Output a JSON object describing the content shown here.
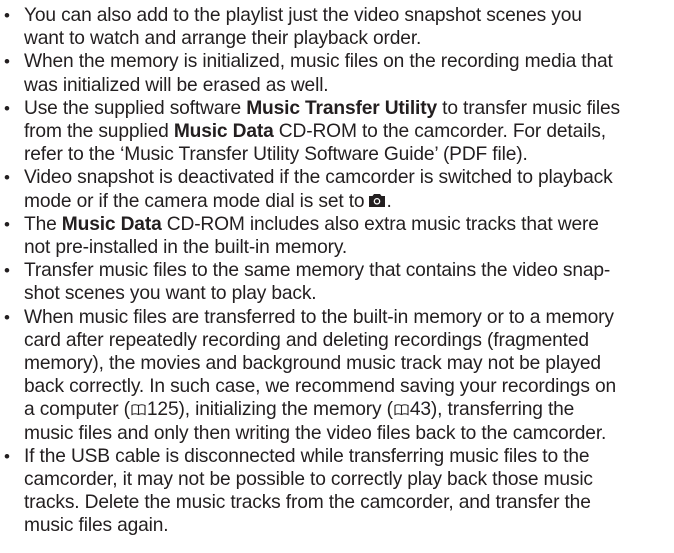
{
  "notes": [
    {
      "lines": [
        "You can also add to the playlist just the video snapshot scenes you",
        "want to watch and arrange their playback order."
      ]
    },
    {
      "lines": [
        "When the memory is initialized, music files on the recording media that",
        "was initialized will be erased as well."
      ]
    },
    {
      "l1a": "Use the supplied software ",
      "l1b": "Music Transfer Utility",
      "l1c": " to transfer music files",
      "l2a": "from the supplied ",
      "l2b": "Music Data",
      "l2c": " CD-ROM to the camcorder. For details,",
      "l3": "refer to the ‘Music Transfer Utility Software Guide’ (PDF file)."
    },
    {
      "l1": "Video snapshot is deactivated if the camcorder is switched to playback",
      "l2a": "mode or if the camera mode dial is set to",
      "l2b": ".",
      "icon": "camera-icon"
    },
    {
      "l1a": "The ",
      "l1b": "Music Data",
      "l1c": " CD-ROM includes also extra music tracks that were",
      "l2": "not pre-installed in the built-in memory."
    },
    {
      "lines": [
        "Transfer music files to the same memory that contains the video snap-",
        "shot scenes you want to play back."
      ]
    },
    {
      "l1": "When music files are transferred to the built-in memory or to a memory",
      "l2": "card after repeatedly recording and deleting recordings (fragmented",
      "l3": "memory), the movies and background music track may not be played",
      "l4": "back correctly. In such case, we recommend saving your recordings on",
      "l5a": "a computer (",
      "ref1": "125",
      "l5b": "), initializing the memory (",
      "ref2": "43",
      "l5c": "), transferring the",
      "l6": "music files and only then writing the video files back to the camcorder.",
      "icon": "book-reference-icon"
    },
    {
      "lines": [
        "If the USB cable is disconnected while transferring music files to the",
        "camcorder, it may not be possible to correctly play back those music",
        "tracks. Delete the music tracks from the camcorder, and transfer the",
        "music files again."
      ]
    }
  ],
  "bullet": "•"
}
